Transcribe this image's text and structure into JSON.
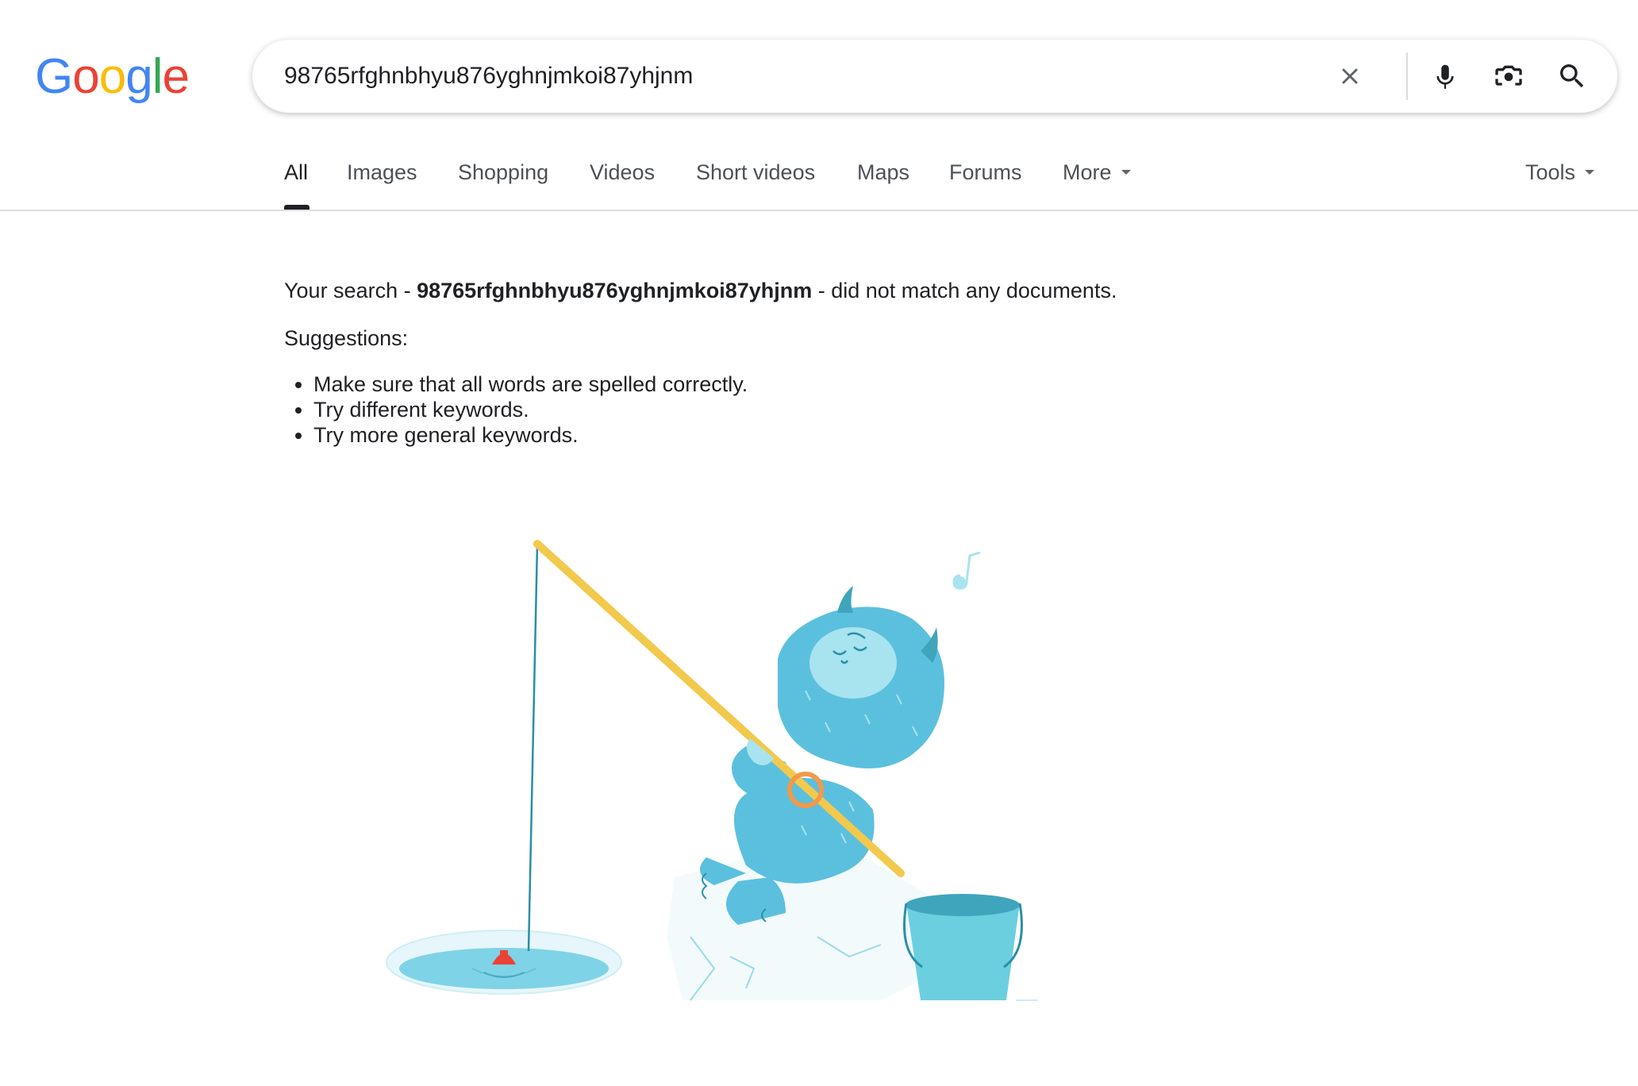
{
  "logo": {
    "letters": [
      "G",
      "o",
      "o",
      "g",
      "l",
      "e"
    ],
    "colors": [
      "#4285F4",
      "#EA4335",
      "#FBBC05",
      "#4285F4",
      "#34A853",
      "#EA4335"
    ]
  },
  "search": {
    "query": "98765rfghnbhyu876yghnjmkoi87yhjnm",
    "icons": [
      "close-icon",
      "microphone-icon",
      "camera-lens-icon",
      "search-icon"
    ]
  },
  "tabs": {
    "items": [
      {
        "label": "All",
        "active": true
      },
      {
        "label": "Images"
      },
      {
        "label": "Shopping"
      },
      {
        "label": "Videos"
      },
      {
        "label": "Short videos"
      },
      {
        "label": "Maps"
      },
      {
        "label": "Forums"
      },
      {
        "label": "More"
      }
    ],
    "tools_label": "Tools"
  },
  "results": {
    "prefix": "Your search - ",
    "query": "98765rfghnbhyu876yghnjmkoi87yhjnm",
    "suffix": " - did not match any documents.",
    "suggestions_title": "Suggestions:",
    "suggestions": [
      "Make sure that all words are spelled correctly.",
      "Try different keywords.",
      "Try more general keywords."
    ]
  },
  "colors": {
    "text": "#202124",
    "tab_text": "#4d5156",
    "icon_gray": "#5f6368",
    "divider": "#dadce0",
    "mic_blue": "#4285F4",
    "yeti": "#5BC0DE",
    "rod": "#F2C94C",
    "bobber": "#EA4335"
  }
}
